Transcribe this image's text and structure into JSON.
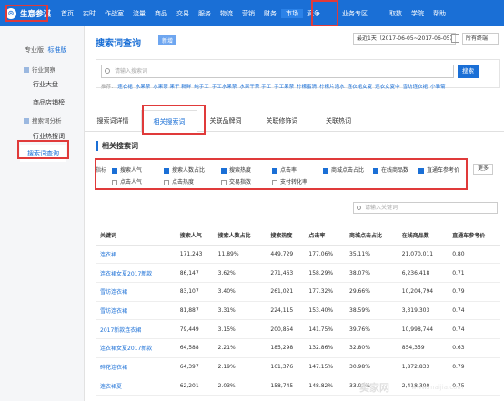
{
  "app": {
    "logo_icon": "⊙",
    "name": "生意参谋"
  },
  "nav": [
    "首页",
    "实时",
    "作战室",
    "流量",
    "商品",
    "交易",
    "服务",
    "物流",
    "营销",
    "财务",
    "市场",
    "竞争",
    "业务专区",
    "取数",
    "学院",
    "帮助"
  ],
  "sidebar": {
    "edition": "专业版",
    "edition_active": "标准版",
    "groups": [
      {
        "label": "行业洞察",
        "items": [
          "行业大盘",
          "商品店铺榜"
        ]
      },
      {
        "label": "搜索词分析",
        "items": [
          "行业热搜词",
          "搜索词查询"
        ]
      }
    ]
  },
  "page": {
    "title": "搜索词查询",
    "badge": "新增",
    "date_range": "最近1天（2017-06-05~2017-06-05）",
    "terminal": "所有终端"
  },
  "search": {
    "placeholder": "请输入搜索词",
    "button": "搜索",
    "hot_label": "推荐：",
    "hot_words": [
      "连衣裙",
      "水果茶",
      "水果茶 果干 新鲜",
      "纯手工",
      "手工水果茶",
      "水果干茶 手工",
      "手工果茶",
      "柠檬蜜清",
      "柠檬片泡水",
      "连衣裙女夏",
      "连衣女夏中",
      "雪纺连衣裙",
      "小雏菊"
    ]
  },
  "tabs": [
    "搜索词详情",
    "相关搜索词",
    "关联品牌词",
    "关联修饰词",
    "关联热词"
  ],
  "section_title": "相关搜索词",
  "metrics": {
    "label": "指标",
    "items": [
      {
        "label": "搜索人气",
        "checked": true
      },
      {
        "label": "搜索人数占比",
        "checked": true
      },
      {
        "label": "搜索热度",
        "checked": true
      },
      {
        "label": "点击率",
        "checked": true
      },
      {
        "label": "商城点击占比",
        "checked": true
      },
      {
        "label": "在线商品数",
        "checked": true
      },
      {
        "label": "直通车参考价",
        "checked": true
      },
      {
        "label": "点击人气",
        "checked": false
      },
      {
        "label": "点击热度",
        "checked": false
      },
      {
        "label": "交易指数",
        "checked": false
      },
      {
        "label": "支付转化率",
        "checked": false
      }
    ],
    "more": "更多"
  },
  "keyword_search": {
    "placeholder": "请输入关键词"
  },
  "table": {
    "headers": [
      "关键词",
      "搜索人气",
      "搜索人数占比",
      "搜索热度",
      "点击率",
      "商城点击占比",
      "在线商品数",
      "直通车参考价"
    ],
    "rows": [
      [
        "连衣裙",
        "171,243",
        "11.89%",
        "449,729",
        "177.06%",
        "35.11%",
        "21,070,011",
        "0.80"
      ],
      [
        "连衣裙女夏2017新款",
        "86,147",
        "3.62%",
        "271,463",
        "158.29%",
        "38.07%",
        "6,236,418",
        "0.71"
      ],
      [
        "雪纺连衣裙",
        "83,107",
        "3.40%",
        "261,021",
        "177.32%",
        "29.66%",
        "10,204,794",
        "0.79"
      ],
      [
        "雪纺连衣裙",
        "81,887",
        "3.31%",
        "224,115",
        "153.40%",
        "38.59%",
        "3,319,303",
        "0.74"
      ],
      [
        "2017新款连衣裙",
        "79,449",
        "3.15%",
        "200,854",
        "141.75%",
        "39.76%",
        "10,998,744",
        "0.74"
      ],
      [
        "连衣裙女夏2017新款",
        "64,588",
        "2.21%",
        "185,298",
        "132.86%",
        "32.80%",
        "854,359",
        "0.63"
      ],
      [
        "碎花连衣裙",
        "64,397",
        "2.19%",
        "161,376",
        "147.15%",
        "30.98%",
        "1,872,833",
        "0.79"
      ],
      [
        "连衣裙夏",
        "62,201",
        "2.03%",
        "158,745",
        "148.82%",
        "33.02%",
        "2,418,300",
        "0.75"
      ]
    ]
  },
  "watermark": {
    "site": "卖家网",
    "url": "www.maijia.com"
  }
}
